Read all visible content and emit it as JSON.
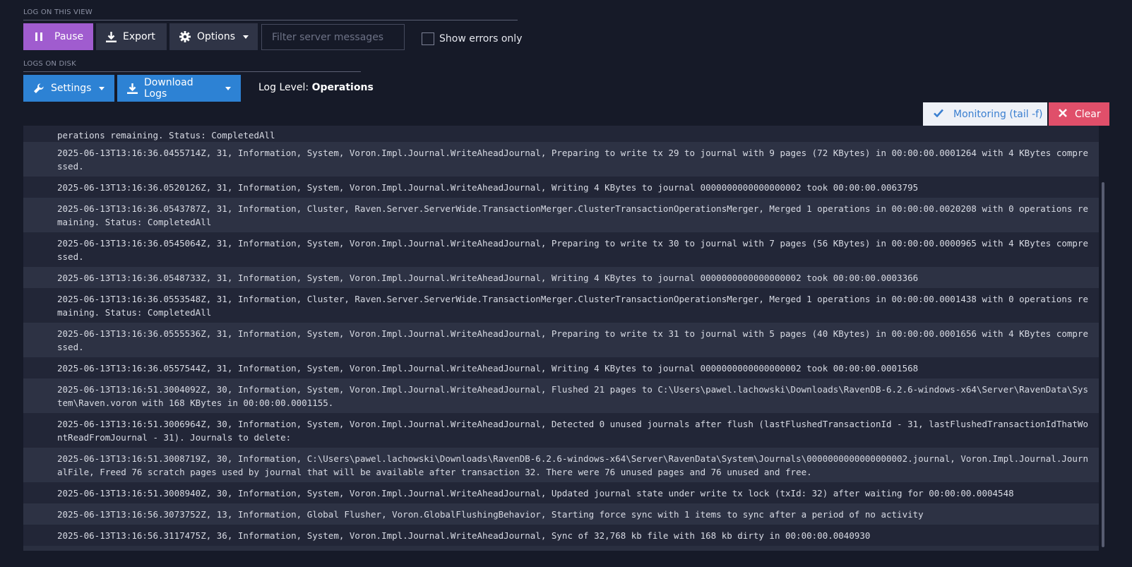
{
  "view_section": {
    "label": "LOG ON THIS VIEW",
    "pause_label": "Pause",
    "export_label": "Export",
    "options_label": "Options",
    "filter_placeholder": "Filter server messages",
    "errors_only_label": "Show errors only"
  },
  "disk_section": {
    "label": "LOGS ON DISK",
    "settings_label": "Settings",
    "download_label": "Download Logs",
    "log_level_prefix": "Log Level:",
    "log_level_value": "Operations"
  },
  "monitor": {
    "monitoring_label": "Monitoring (tail -f)",
    "clear_label": "Clear"
  },
  "colors": {
    "pause": "#a05ccf",
    "primary": "#2d82d4",
    "clear": "#e04f6a",
    "background": "#161a28"
  },
  "log_rows": [
    "perations remaining. Status: CompletedAll",
    "2025-06-13T13:16:36.0455714Z, 31, Information, System, Voron.Impl.Journal.WriteAheadJournal, Preparing to write tx 29 to journal with 9 pages (72 KBytes) in 00:00:00.0001264 with 4 KBytes compressed.",
    "2025-06-13T13:16:36.0520126Z, 31, Information, System, Voron.Impl.Journal.WriteAheadJournal, Writing 4 KBytes to journal 0000000000000000002 took 00:00:00.0063795",
    "2025-06-13T13:16:36.0543787Z, 31, Information, Cluster, Raven.Server.ServerWide.TransactionMerger.ClusterTransactionOperationsMerger, Merged 1 operations in 00:00:00.0020208 with 0 operations remaining. Status: CompletedAll",
    "2025-06-13T13:16:36.0545064Z, 31, Information, System, Voron.Impl.Journal.WriteAheadJournal, Preparing to write tx 30 to journal with 7 pages (56 KBytes) in 00:00:00.0000965 with 4 KBytes compressed.",
    "2025-06-13T13:16:36.0548733Z, 31, Information, System, Voron.Impl.Journal.WriteAheadJournal, Writing 4 KBytes to journal 0000000000000000002 took 00:00:00.0003366",
    "2025-06-13T13:16:36.0553548Z, 31, Information, Cluster, Raven.Server.ServerWide.TransactionMerger.ClusterTransactionOperationsMerger, Merged 1 operations in 00:00:00.0001438 with 0 operations remaining. Status: CompletedAll",
    "2025-06-13T13:16:36.0555536Z, 31, Information, System, Voron.Impl.Journal.WriteAheadJournal, Preparing to write tx 31 to journal with 5 pages (40 KBytes) in 00:00:00.0001656 with 4 KBytes compressed.",
    "2025-06-13T13:16:36.0557544Z, 31, Information, System, Voron.Impl.Journal.WriteAheadJournal, Writing 4 KBytes to journal 0000000000000000002 took 00:00:00.0001568",
    "2025-06-13T13:16:51.3004092Z, 30, Information, System, Voron.Impl.Journal.WriteAheadJournal, Flushed 21 pages to C:\\Users\\pawel.lachowski\\Downloads\\RavenDB-6.2.6-windows-x64\\Server\\RavenData\\System\\Raven.voron with 168 KBytes in 00:00:00.0001155.",
    "2025-06-13T13:16:51.3006964Z, 30, Information, System, Voron.Impl.Journal.WriteAheadJournal, Detected 0 unused journals after flush (lastFlushedTransactionId - 31, lastFlushedTransactionIdThatWontReadFromJournal - 31). Journals to delete:",
    "2025-06-13T13:16:51.3008719Z, 30, Information, C:\\Users\\pawel.lachowski\\Downloads\\RavenDB-6.2.6-windows-x64\\Server\\RavenData\\System\\Journals\\0000000000000000002.journal, Voron.Impl.Journal.JournalFile, Freed 76 scratch pages used by journal that will be available after transaction 32. There were 76 unused pages and 76 unused and free.",
    "2025-06-13T13:16:51.3008940Z, 30, Information, System, Voron.Impl.Journal.WriteAheadJournal, Updated journal state under write tx lock (txId: 32) after waiting for 00:00:00.0004548",
    "2025-06-13T13:16:56.3073752Z, 13, Information, Global Flusher, Voron.GlobalFlushingBehavior, Starting force sync with 1 items to sync after a period of no activity",
    "2025-06-13T13:16:56.3117475Z, 36, Information, System, Voron.Impl.Journal.WriteAheadJournal, Sync of 32,768 kb file with 168 kb dirty in 00:00:00.0040930"
  ]
}
